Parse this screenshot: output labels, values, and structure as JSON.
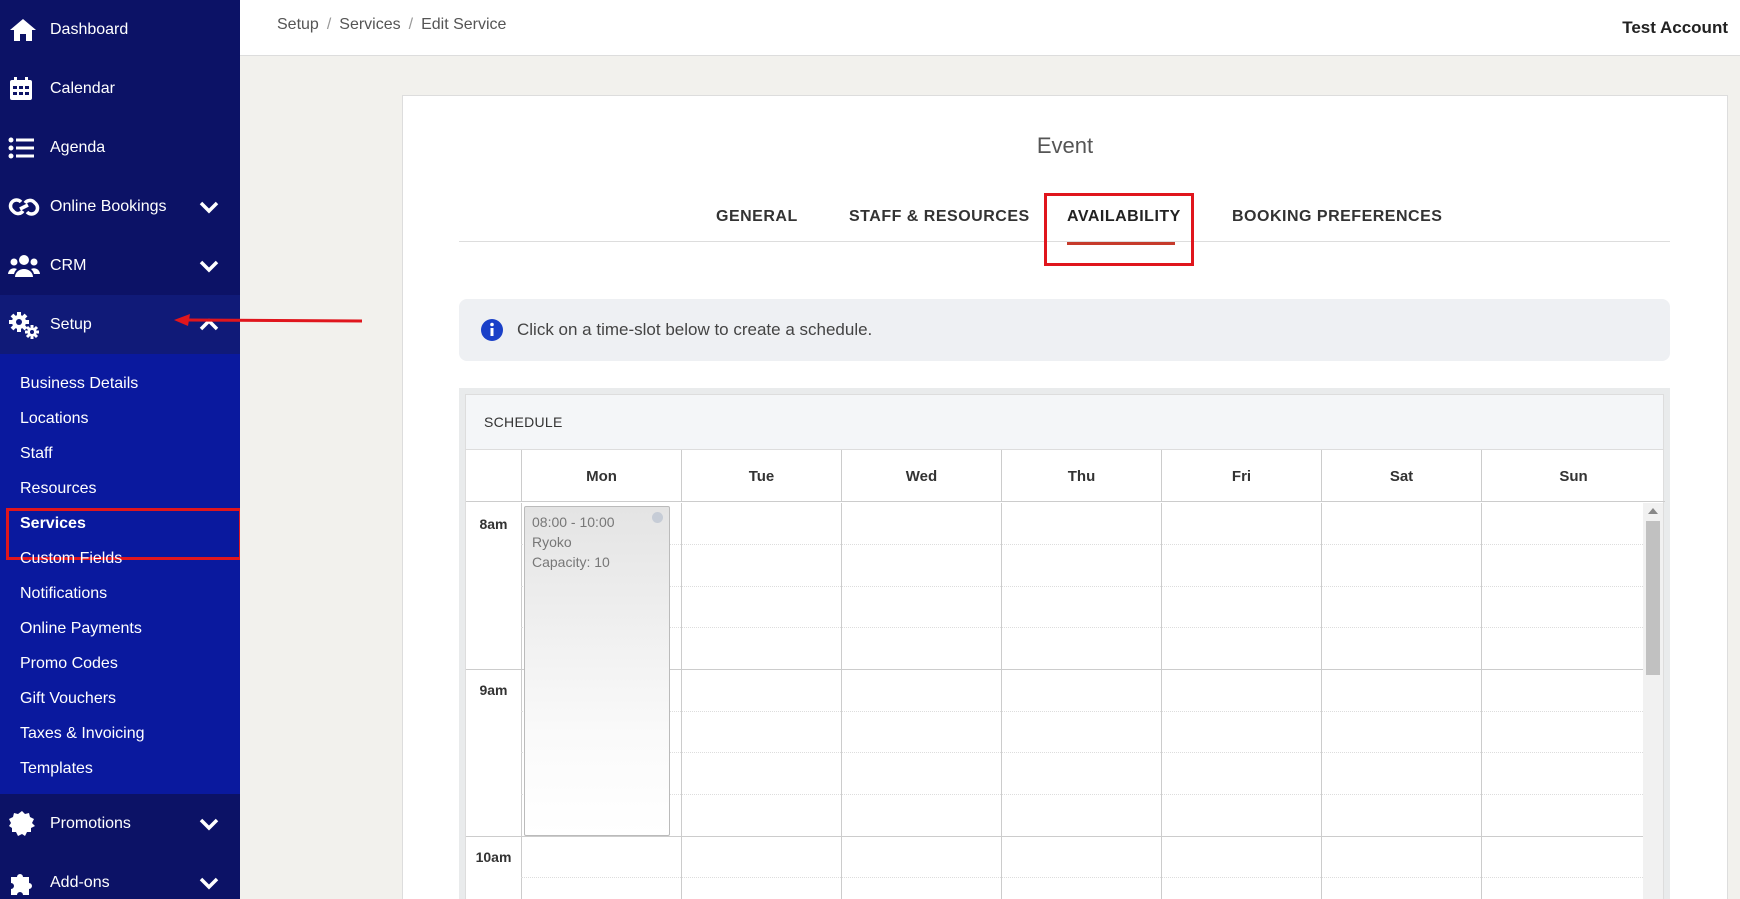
{
  "sidebar": {
    "items": [
      {
        "label": "Dashboard",
        "icon": "home-icon"
      },
      {
        "label": "Calendar",
        "icon": "calendar-icon"
      },
      {
        "label": "Agenda",
        "icon": "list-icon"
      },
      {
        "label": "Online Bookings",
        "icon": "link-icon"
      },
      {
        "label": "CRM",
        "icon": "users-icon"
      },
      {
        "label": "Setup",
        "icon": "gears-icon"
      },
      {
        "label": "Promotions",
        "icon": "badge-icon"
      },
      {
        "label": "Add-ons",
        "icon": "puzzle-icon"
      }
    ],
    "setup_submenu": [
      "Business Details",
      "Locations",
      "Staff",
      "Resources",
      "Services",
      "Custom Fields",
      "Notifications",
      "Online Payments",
      "Promo Codes",
      "Gift Vouchers",
      "Taxes & Invoicing",
      "Templates"
    ]
  },
  "topbar": {
    "breadcrumb": [
      "Setup",
      "Services",
      "Edit Service"
    ],
    "separator": "/",
    "account": "Test Account"
  },
  "card": {
    "title": "Event",
    "tabs": [
      "GENERAL",
      "STAFF & RESOURCES",
      "AVAILABILITY",
      "BOOKING PREFERENCES"
    ],
    "selected_tab": "AVAILABILITY",
    "info": "Click on a time-slot below to create a schedule."
  },
  "schedule": {
    "header": "SCHEDULE",
    "days": [
      "Mon",
      "Tue",
      "Wed",
      "Thu",
      "Fri",
      "Sat",
      "Sun"
    ],
    "times": [
      "8am",
      "9am",
      "10am"
    ],
    "event": {
      "time": "08:00 - 10:00",
      "staff": "Ryoko",
      "capacity": "Capacity: 10"
    }
  },
  "colors": {
    "sidebar_bg": "#0c1266",
    "submenu_bg": "#0a199e",
    "highlight_red": "#e0161d",
    "tab_underline": "#c63b2c",
    "info_icon": "#1a40c8"
  }
}
